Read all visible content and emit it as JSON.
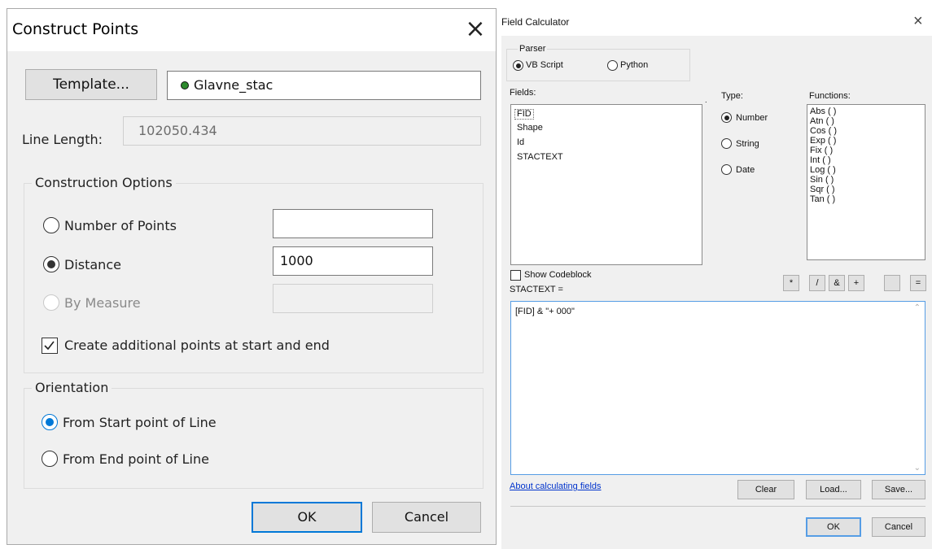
{
  "construct_points": {
    "title": "Construct Points",
    "template_button": "Template...",
    "template_value": "Glavne_stac",
    "line_length_label": "Line Length:",
    "line_length_value": "102050.434",
    "construction_options_label": "Construction Options",
    "number_of_points_label": "Number of Points",
    "number_of_points_value": "",
    "distance_label": "Distance",
    "distance_value": "1000",
    "by_measure_label": "By Measure",
    "by_measure_value": "",
    "additional_points_label": "Create additional points at start and end",
    "additional_points_checked": true,
    "orientation_label": "Orientation",
    "from_start_label": "From Start point of Line",
    "from_end_label": "From End point of Line",
    "ok_label": "OK",
    "cancel_label": "Cancel",
    "accent_color": "#0078d7",
    "template_dot_color": "#2d8a2d"
  },
  "field_calculator": {
    "title": "Field Calculator",
    "parser_label": "Parser",
    "vbscript_label": "VB Script",
    "python_label": "Python",
    "fields_label": "Fields:",
    "fields": [
      "FID",
      "Shape",
      "Id",
      "STACTEXT"
    ],
    "type_label": "Type:",
    "number_label": "Number",
    "string_label": "String",
    "date_label": "Date",
    "functions_label": "Functions:",
    "functions": [
      "Abs ( )",
      "Atn ( )",
      "Cos ( )",
      "Exp ( )",
      "Fix ( )",
      "Int ( )",
      "Log ( )",
      "Sin ( )",
      "Sqr ( )",
      "Tan ( )"
    ],
    "show_codeblock_label": "Show Codeblock",
    "operators": [
      "*",
      "/",
      "&",
      "+",
      "",
      "="
    ],
    "expression_label": "STACTEXT =",
    "expression": "[FID] & \"+ 000\"",
    "about_link": "About calculating fields",
    "clear_label": "Clear",
    "load_label": "Load...",
    "save_label": "Save...",
    "ok_label": "OK",
    "cancel_label": "Cancel"
  }
}
